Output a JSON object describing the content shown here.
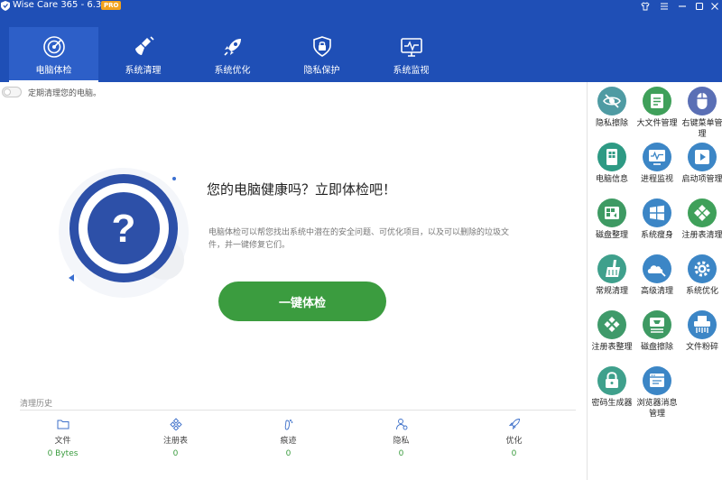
{
  "app": {
    "title": "Wise Care 365 - 6.3.1",
    "badge": "PRO",
    "accent_color": "#1f4fb6",
    "window_controls": [
      "shirt-icon",
      "menu-icon",
      "minimize-icon",
      "maximize-icon",
      "close-icon"
    ]
  },
  "nav": {
    "tabs": [
      {
        "label": "电脑体检",
        "icon": "radar-icon",
        "active": true
      },
      {
        "label": "系统清理",
        "icon": "broom-icon",
        "active": false
      },
      {
        "label": "系统优化",
        "icon": "rocket-icon",
        "active": false
      },
      {
        "label": "隐私保护",
        "icon": "lock-shield-icon",
        "active": false
      },
      {
        "label": "系统监视",
        "icon": "monitor-icon",
        "active": false
      }
    ]
  },
  "main": {
    "toggle_label": "定期清理您的电脑。",
    "headline": "您的电脑健康吗？立即体检吧！",
    "description": "电脑体检可以帮您找出系统中潜在的安全问题、可优化项目，以及可以删除的垃圾文件，并一键修复它们。",
    "scan_button": "一键体检",
    "history_title": "清理历史",
    "stats": [
      {
        "label": "文件",
        "value": "0 Bytes",
        "icon": "folder-icon"
      },
      {
        "label": "注册表",
        "value": "0",
        "icon": "registry-icon"
      },
      {
        "label": "痕迹",
        "value": "0",
        "icon": "footprint-icon"
      },
      {
        "label": "隐私",
        "value": "0",
        "icon": "privacy-icon"
      },
      {
        "label": "优化",
        "value": "0",
        "icon": "rocket-icon"
      }
    ],
    "stat_value_color": "#3b9c3f",
    "scan_button_color": "#3b9c3f"
  },
  "tools": [
    {
      "label": "隐私擦除",
      "icon": "eye-slash-icon",
      "color": "#4f9ba3"
    },
    {
      "label": "大文件管理",
      "icon": "file-list-icon",
      "color": "#3fa05a"
    },
    {
      "label": "右键菜单管理",
      "icon": "mouse-icon",
      "color": "#5a6fb5"
    },
    {
      "label": "电脑信息",
      "icon": "computer-info-icon",
      "color": "#2e9a84"
    },
    {
      "label": "进程监视",
      "icon": "process-monitor-icon",
      "color": "#3c86c6"
    },
    {
      "label": "启动项管理",
      "icon": "startup-icon",
      "color": "#3c86c6"
    },
    {
      "label": "磁盘整理",
      "icon": "disk-defrag-icon",
      "color": "#3e9a63"
    },
    {
      "label": "系统瘦身",
      "icon": "windows-icon",
      "color": "#3c86c6"
    },
    {
      "label": "注册表清理",
      "icon": "registry-clean-icon",
      "color": "#3fa05a"
    },
    {
      "label": "常规清理",
      "icon": "broom-icon",
      "color": "#3fa08c"
    },
    {
      "label": "高级清理",
      "icon": "cloud-clean-icon",
      "color": "#3c86c6"
    },
    {
      "label": "系统优化",
      "icon": "gear-icon",
      "color": "#3c86c6"
    },
    {
      "label": "注册表整理",
      "icon": "registry-defrag-icon",
      "color": "#3f9a6a"
    },
    {
      "label": "磁盘擦除",
      "icon": "disk-wipe-icon",
      "color": "#3e9a63"
    },
    {
      "label": "文件粉碎",
      "icon": "shredder-icon",
      "color": "#3c86c6"
    },
    {
      "label": "密码生成器",
      "icon": "password-lock-icon",
      "color": "#3fa08c"
    },
    {
      "label": "浏览器消息管理",
      "icon": "browser-icon",
      "color": "#3c86c6"
    }
  ]
}
